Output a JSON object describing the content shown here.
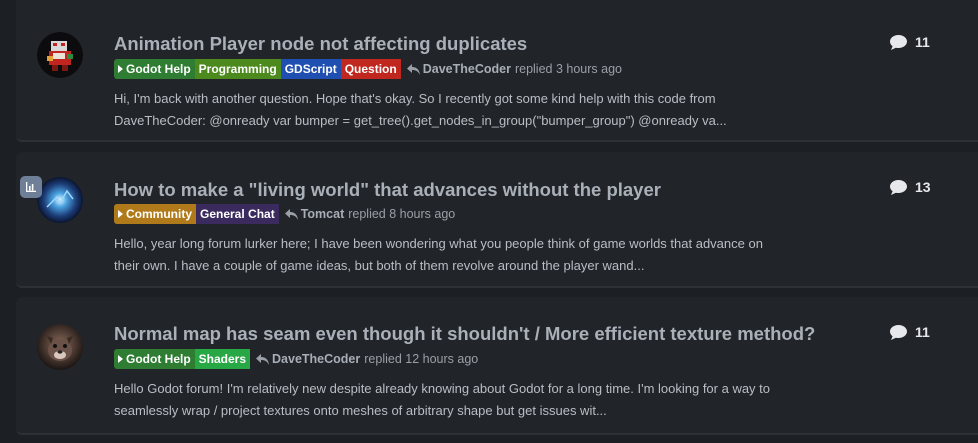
{
  "topics": [
    {
      "title": "Animation Player node not affecting duplicates",
      "tags": [
        {
          "label": "Godot Help",
          "color": "#2e7d32",
          "arrow": true
        },
        {
          "label": "Programming",
          "color": "#4c8a1e",
          "arrow": false
        },
        {
          "label": "GDScript",
          "color": "#1f4fb0",
          "arrow": false
        },
        {
          "label": "Question",
          "color": "#c0281f",
          "arrow": false
        }
      ],
      "last_poster": "DaveTheCoder",
      "activity": "replied 3 hours ago",
      "excerpt_line1": "Hi, I'm back with another question. Hope that's okay. So I recently got some kind help with this code from",
      "excerpt_line2": "DaveTheCoder: @onready var bumper = get_tree().get_nodes_in_group(\"bumper_group\") @onready va...",
      "reply_count": "11",
      "has_poll": false
    },
    {
      "title": "How to make a \"living world\" that advances without the player",
      "tags": [
        {
          "label": "Community",
          "color": "#b07a1a",
          "arrow": true
        },
        {
          "label": "General Chat",
          "color": "#3a2a5e",
          "arrow": false
        }
      ],
      "last_poster": "Tomcat",
      "activity": "replied 8 hours ago",
      "excerpt_line1": "Hello, year long forum lurker here; I have been wondering what you people think of game worlds that advance on",
      "excerpt_line2": "their own. I have a couple of game ideas, but both of them revolve around the player wand...",
      "reply_count": "13",
      "has_poll": true
    },
    {
      "title": "Normal map has seam even though it shouldn't / More efficient texture method?",
      "tags": [
        {
          "label": "Godot Help",
          "color": "#2e7d32",
          "arrow": true
        },
        {
          "label": "Shaders",
          "color": "#27a845",
          "arrow": false
        }
      ],
      "last_poster": "DaveTheCoder",
      "activity": "replied 12 hours ago",
      "excerpt_line1": "Hello Godot forum! I'm relatively new despite already knowing about Godot for a long time. I'm looking for a way to",
      "excerpt_line2": "seamlessly wrap / project textures onto meshes of arbitrary shape but get issues wit...",
      "reply_count": "11",
      "has_poll": false
    }
  ],
  "icons": {
    "reply": "reply-arrow-icon",
    "comment": "comment-bubble-icon",
    "poll": "poll-chart-icon"
  }
}
